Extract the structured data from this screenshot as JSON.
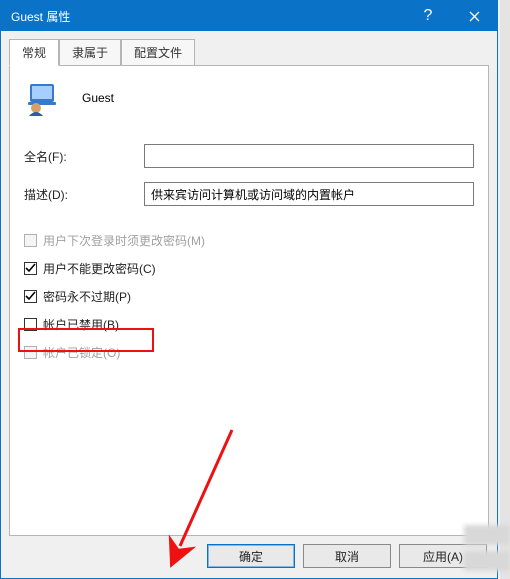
{
  "titlebar": {
    "title": "Guest 属性"
  },
  "tabs": {
    "general": "常规",
    "memberof": "隶属于",
    "profile": "配置文件"
  },
  "user": {
    "name": "Guest"
  },
  "fields": {
    "fullname_label": "全名(F):",
    "fullname_value": "",
    "description_label": "描述(D):",
    "description_value": "供来宾访问计算机或访问域的内置帐户"
  },
  "checks": {
    "must_change": "用户下次登录时须更改密码(M)",
    "cannot_change": "用户不能更改密码(C)",
    "never_expires": "密码永不过期(P)",
    "disabled": "帐户已禁用(B)",
    "locked": "帐户已锁定(O)"
  },
  "buttons": {
    "ok": "确定",
    "cancel": "取消",
    "apply": "应用(A)"
  }
}
